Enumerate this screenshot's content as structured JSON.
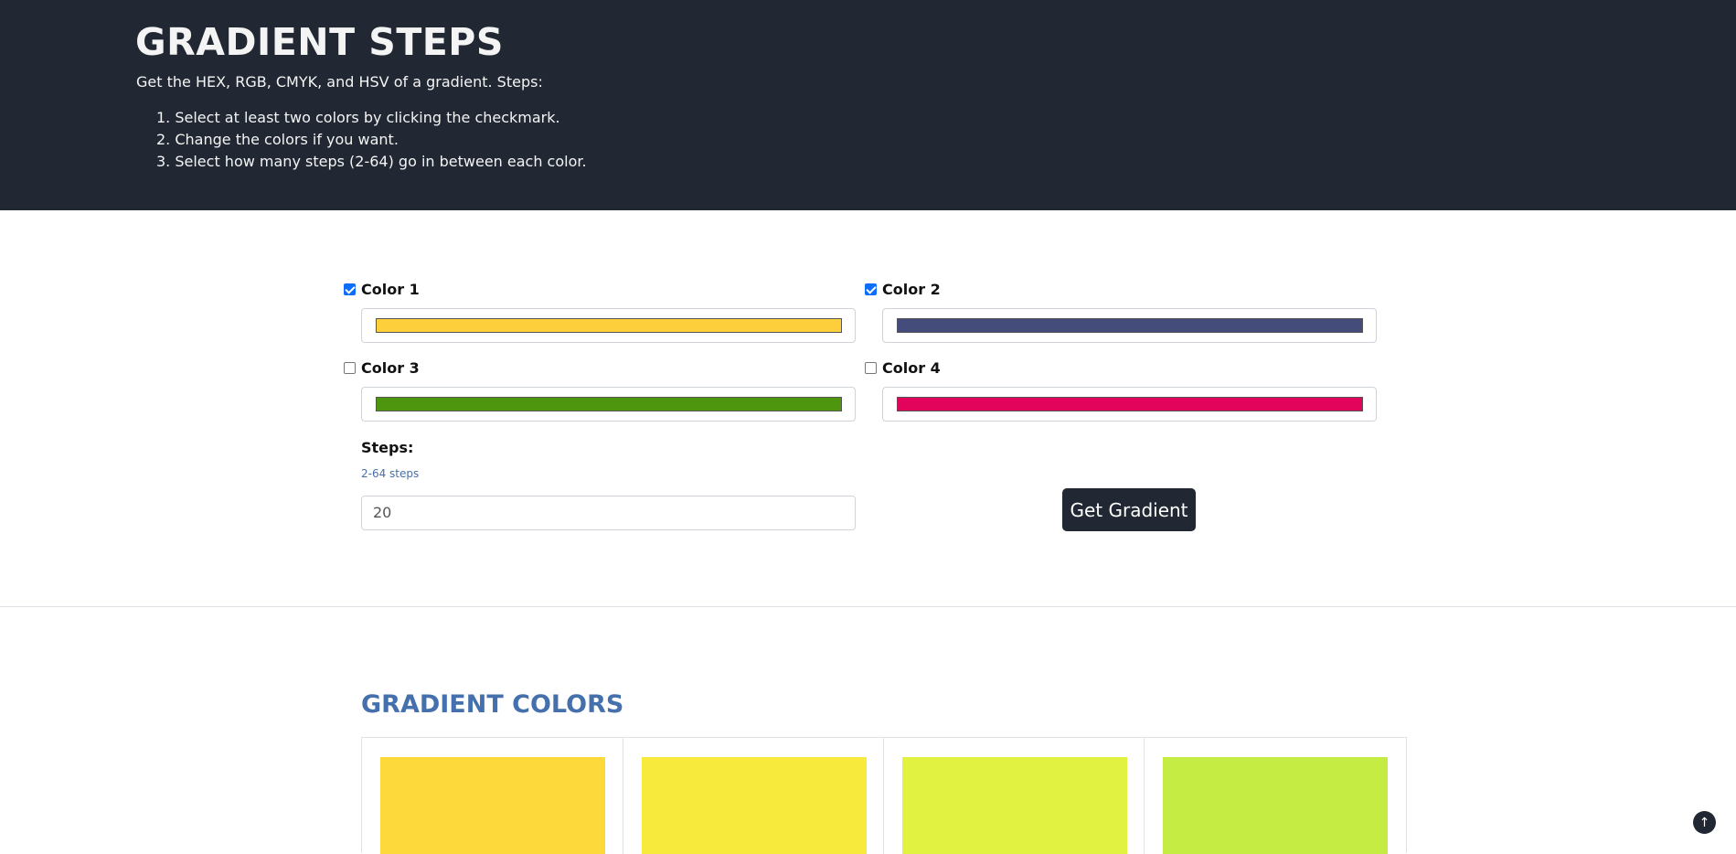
{
  "header": {
    "title": "GRADIENT STEPS",
    "intro": "Get the HEX, RGB, CMYK, and HSV of a gradient. Steps:",
    "steps": [
      {
        "num": "1.",
        "text": "Select at least two colors by clicking the checkmark."
      },
      {
        "num": "2.",
        "text": "Change the colors if you want."
      },
      {
        "num": "3.",
        "text": "Select how many steps (2-64) go in between each color."
      }
    ]
  },
  "colors": [
    {
      "label": "Color 1",
      "checked": true,
      "value": "#fdd03b"
    },
    {
      "label": "Color 2",
      "checked": true,
      "value": "#434c7a"
    },
    {
      "label": "Color 3",
      "checked": false,
      "value": "#4e960d"
    },
    {
      "label": "Color 4",
      "checked": false,
      "value": "#e2045a"
    }
  ],
  "steps_field": {
    "label": "Steps:",
    "help": "2-64 steps",
    "value": "20"
  },
  "get_gradient_button": "Get Gradient",
  "results": {
    "title": "GRADIENT COLORS",
    "swatches": [
      "#fed93b",
      "#f8ea3d",
      "#e2f241",
      "#c4ec43"
    ]
  },
  "back_to_top_icon": "arrow-up-icon"
}
